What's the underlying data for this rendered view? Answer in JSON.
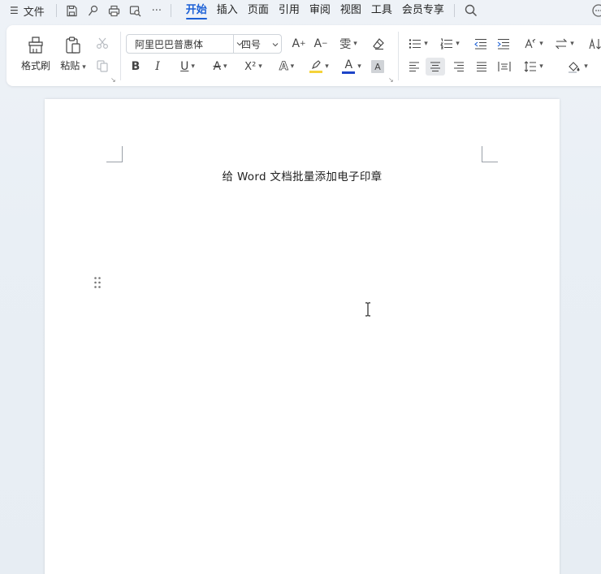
{
  "menubar": {
    "file_label": "文件",
    "tabs": [
      {
        "label": "开始",
        "active": true
      },
      {
        "label": "插入",
        "active": false
      },
      {
        "label": "页面",
        "active": false
      },
      {
        "label": "引用",
        "active": false
      },
      {
        "label": "审阅",
        "active": false
      },
      {
        "label": "视图",
        "active": false
      },
      {
        "label": "工具",
        "active": false
      },
      {
        "label": "会员专享",
        "active": false
      }
    ],
    "quick_access_icons": [
      "save-icon",
      "export-icon",
      "print-icon",
      "print-preview-icon",
      "more-icon"
    ],
    "more_label": "···"
  },
  "ribbon": {
    "format_painter_label": "格式刷",
    "paste_label": "粘贴",
    "font_name": "阿里巴巴普惠体",
    "font_size": "四号",
    "increase_font_label": "A",
    "decrease_font_label": "A",
    "phonetic_label": "雯",
    "bold_label": "B",
    "italic_label": "I",
    "underline_label": "U",
    "strike_label": "A",
    "superscript_label": "X²",
    "text_effect_label": "A",
    "font_color_label": "A",
    "char_shading_label": "A",
    "highlight_color": "#f5d33a",
    "font_color": "#1d44c8",
    "char_shading_bg": "#d0d3d7"
  },
  "document": {
    "title": "给 Word 文档批量添加电子印章"
  },
  "colors": {
    "accent": "#1a5fd6",
    "page": "#ffffff",
    "background": "#e9eff5"
  }
}
